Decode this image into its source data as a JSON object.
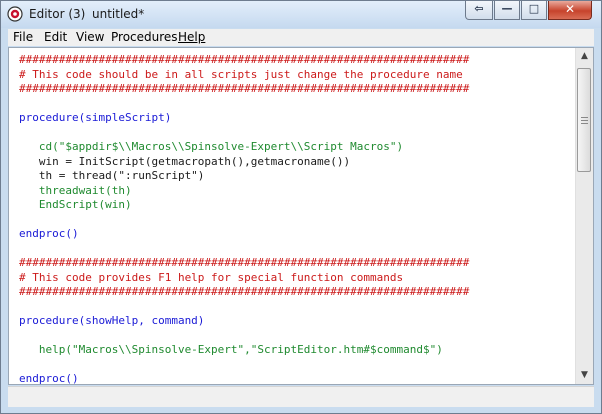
{
  "window": {
    "app_title": "Editor (3)",
    "document_title": "untitled*"
  },
  "title_controls": {
    "back_symbol": "⇦",
    "minimize_symbol": "—",
    "maximize_symbol": "□",
    "close_symbol": "✕"
  },
  "menu": {
    "items": [
      "File",
      "Edit",
      "View",
      "Procedures",
      "Help"
    ]
  },
  "code_lines": [
    "####################################################################",
    "# This code should be in all scripts just change the procedure name",
    "####################################################################",
    "",
    "procedure(simpleScript)",
    "",
    "   cd(\"$appdir$\\\\Macros\\\\Spinsolve-Expert\\\\Script Macros\")",
    "   win = InitScript(getmacropath(),getmacroname())",
    "   th = thread(\":runScript\")",
    "   threadwait(th)",
    "   EndScript(win)",
    "",
    "endproc()",
    "",
    "####################################################################",
    "# This code provides F1 help for special function commands",
    "####################################################################",
    "",
    "procedure(showHelp, command)",
    "",
    "   help(\"Macros\\\\Spinsolve-Expert\",\"ScriptEditor.htm#$command$\")",
    "",
    "endproc()"
  ],
  "syntax_colors": {
    "comment": "#cc1a1a",
    "keyword": "#1a1ad6",
    "function": "#1f8a2f",
    "plain": "#1a1a1a"
  },
  "scrollbar": {
    "up_symbol": "▲",
    "down_symbol": "▼"
  }
}
